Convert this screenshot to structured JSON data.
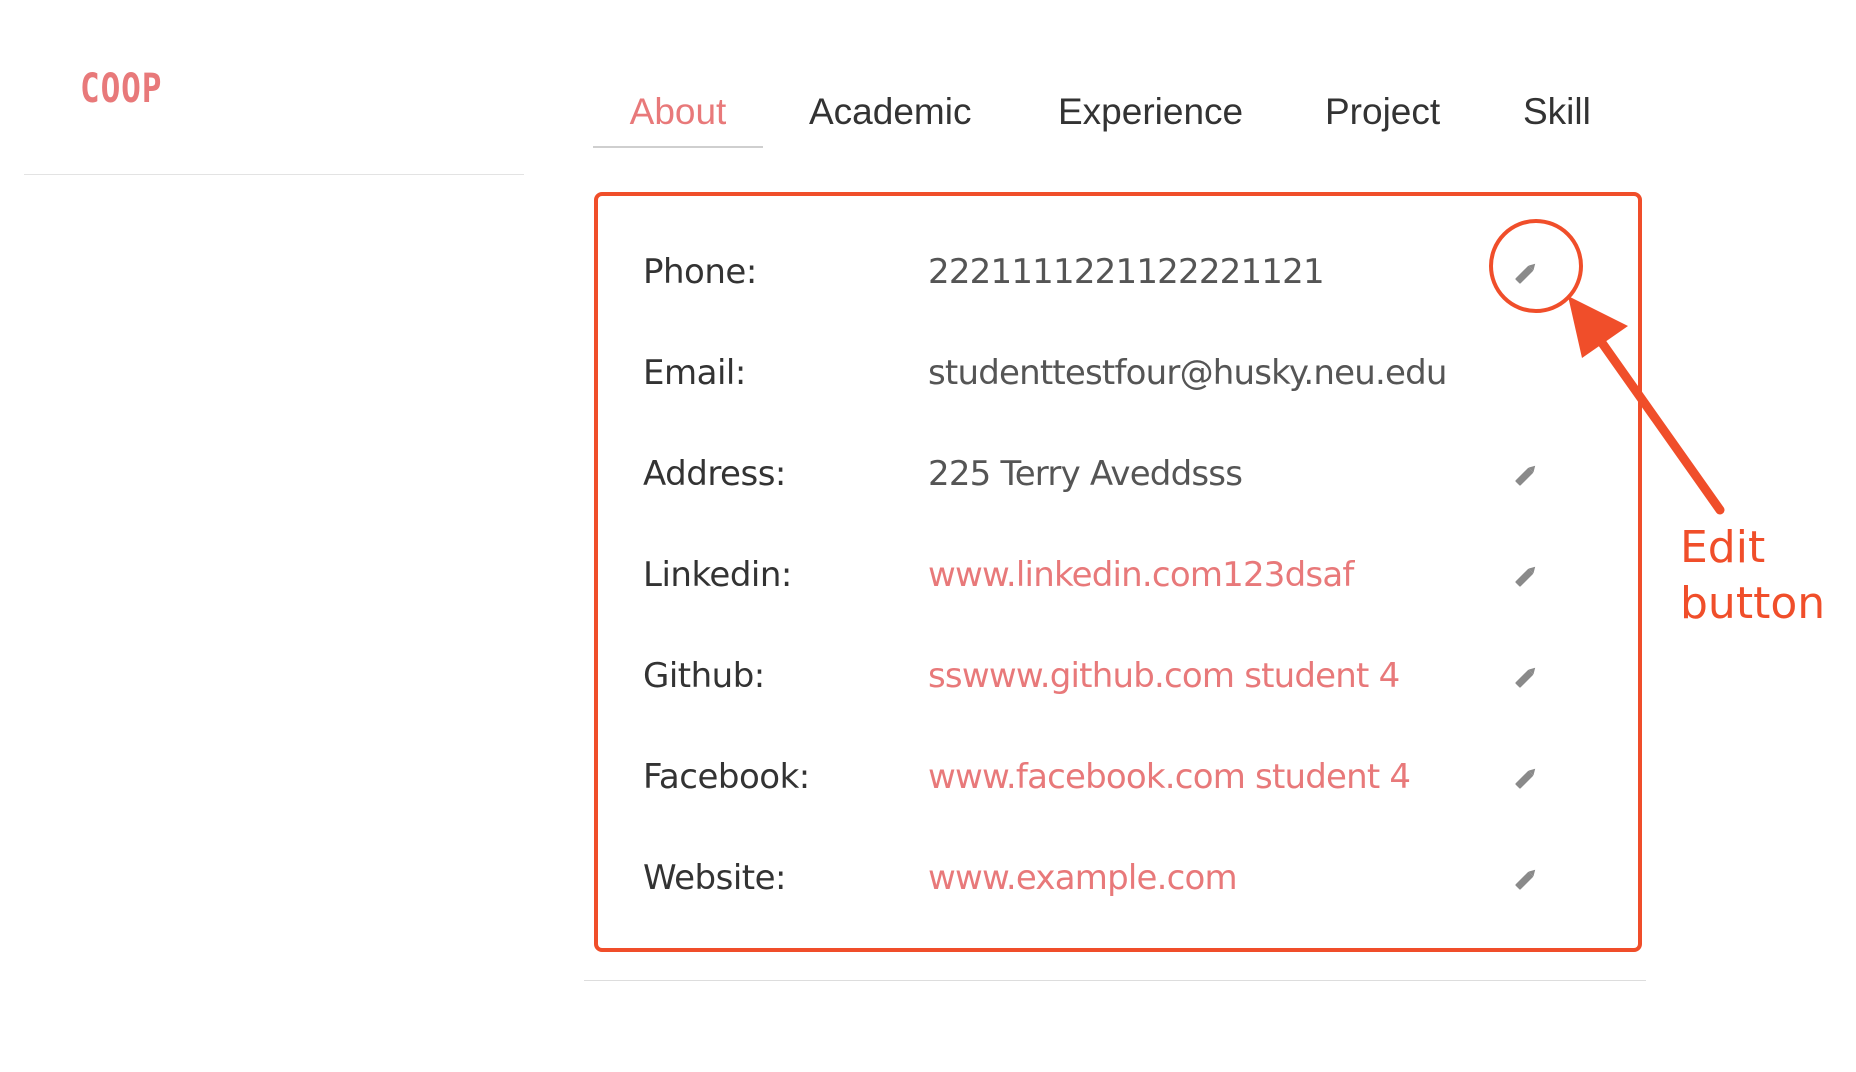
{
  "brand": {
    "name": "COOP",
    "color": "#e8797a"
  },
  "tabs": [
    {
      "label": "About",
      "active": true
    },
    {
      "label": "Academic",
      "active": false
    },
    {
      "label": "Experience",
      "active": false
    },
    {
      "label": "Project",
      "active": false
    },
    {
      "label": "Skill",
      "active": false
    }
  ],
  "profile": {
    "rows": [
      {
        "label": "Phone:",
        "value": "2221111221122221121",
        "is_link": false,
        "editable": true
      },
      {
        "label": "Email:",
        "value": "studenttestfour@husky.neu.edu",
        "is_link": false,
        "editable": false
      },
      {
        "label": "Address:",
        "value": "225 Terry Aveddsss",
        "is_link": false,
        "editable": true
      },
      {
        "label": "Linkedin:",
        "value": "www.linkedin.com123dsaf",
        "is_link": true,
        "editable": true
      },
      {
        "label": "Github:",
        "value": "sswww.github.com student 4",
        "is_link": true,
        "editable": true
      },
      {
        "label": "Facebook:",
        "value": "www.facebook.com student 4",
        "is_link": true,
        "editable": true
      },
      {
        "label": "Website:",
        "value": "www.example.com",
        "is_link": true,
        "editable": true
      }
    ]
  },
  "annotation": {
    "line1": "Edit",
    "line2": "button",
    "color": "#f04e2a"
  },
  "colors": {
    "accent": "#e8797a",
    "link": "#e8797a",
    "highlight": "#f04e2a",
    "text": "#333333",
    "value_text": "#555555",
    "icon": "#8a8a8a"
  },
  "icons": {
    "edit": "pencil-icon"
  }
}
